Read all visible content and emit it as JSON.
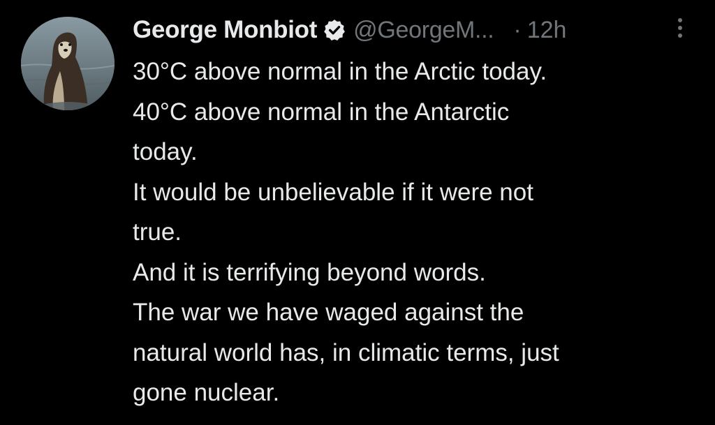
{
  "author": {
    "display_name": "George Monbiot",
    "handle": "@GeorgeM...",
    "separator": "·",
    "timestamp": "12h",
    "avatar_icon": "otter-avatar",
    "verified_icon": "verified-badge-icon"
  },
  "tweet": {
    "lines": [
      "30°C above normal in the Arctic today.",
      "40°C above normal in the Antarctic",
      "today.",
      "It would be unbelievable if it were not",
      "true.",
      "And it is terrifying beyond words.",
      "The war we have waged against the",
      "natural world has, in climatic terms, just",
      "gone nuclear."
    ]
  },
  "colors": {
    "background": "#000000",
    "text": "#e7e9ea",
    "secondary": "#71767b"
  }
}
